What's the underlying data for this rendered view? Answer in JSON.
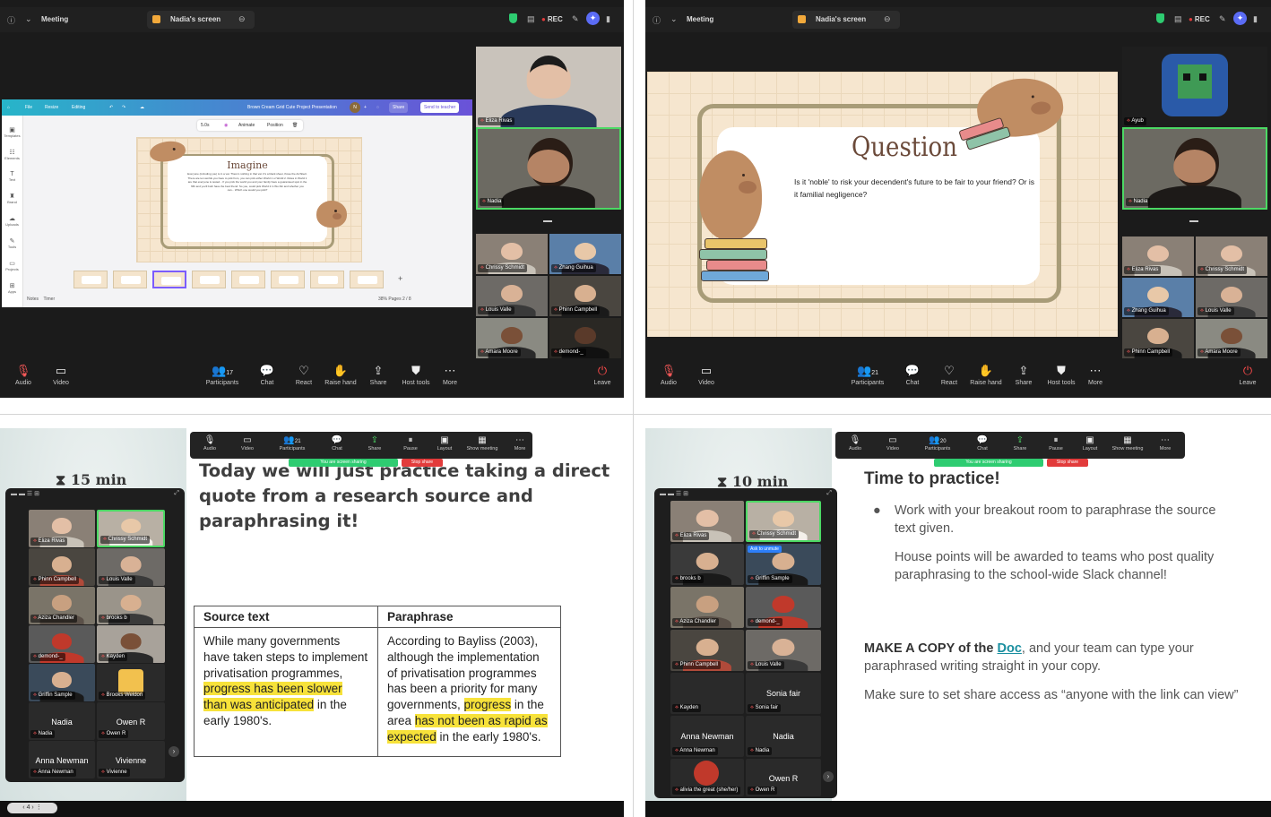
{
  "window": {
    "meeting_label": "Meeting",
    "share_tab": "Nadia's screen",
    "rec": "REC"
  },
  "toolbar": {
    "audio": "Audio",
    "video": "Video",
    "participants": "Participants",
    "chat": "Chat",
    "react": "React",
    "raise_hand": "Raise hand",
    "share": "Share",
    "host_tools": "Host tools",
    "more": "More",
    "leave": "Leave",
    "pause": "Pause",
    "layout": "Layout",
    "show_meeting": "Show meeting"
  },
  "participant_counts": {
    "p1": "17",
    "p2": "21",
    "p3": "21",
    "p4": "20"
  },
  "sharing": {
    "you_are_sharing": "You are screen sharing",
    "stop_share": "Stop share"
  },
  "p1": {
    "canva": {
      "menu": [
        "File",
        "Resize",
        "Editing"
      ],
      "doc_title": "Brown Cream Grid Cute Project Presentation",
      "share": "Share",
      "send_to_teacher": "Send to teacher",
      "tools": [
        "5.0s",
        "Animate",
        "Position"
      ],
      "sidebar": [
        "Templates",
        "Elements",
        "Text",
        "Brand",
        "Uploads",
        "Tools",
        "Projects",
        "Apps"
      ],
      "slide_title": "Imagine",
      "slide_text": "Everyone (including you) is in a vat. There's nothing in that vat. It's a black sheet, those the Architect. There are ten worlds you have to pick from, you can pick either World 1 or World 2. Rules in World 1 are that everyone is tested... If you pick the world you and your family have a guaranteed spot in the fifth and you'll both have the best friend. So you, could pick World 2 in Wo Ric and whether you can... Which one would you pick?",
      "footer_left": [
        "Notes",
        "Timer"
      ],
      "footer_right": "38%   Pages   2 / 8"
    },
    "tiles": [
      "Eliza Rivas",
      "Nadia",
      "Chrissy Schmidt",
      "Zhang Guihua",
      "Louis Valle",
      "Phinn Campbell",
      "Amara Moore",
      "demond-_"
    ]
  },
  "p2": {
    "slide": {
      "title": "Question",
      "text": "Is it 'noble' to risk your decendent's future to be fair to your friend? Or is it familial negligence?"
    },
    "tiles": [
      "Ayub",
      "Nadia",
      "Eliza Rivas",
      "Chrissy Schmidt",
      "Zhang Guihua",
      "Louis Valle",
      "Phinn Campbell",
      "Amara Moore"
    ]
  },
  "p3": {
    "timer": "15 min",
    "heading": "Today we will just practice taking a direct quote from a research source and paraphrasing it!",
    "table": {
      "headers": [
        "Source text",
        "Paraphrase"
      ],
      "source_before": "While many governments have taken steps to implement privatisation programmes, ",
      "source_hl": "progress has been slower than was anticipated",
      "source_after": " in the early 1980's.",
      "para_before": "According to Bayliss (2003), although the implementation of privatisation programmes has been a priority for many governments, ",
      "para_hl1": "progress",
      "para_mid": " in the area ",
      "para_hl2": "has not been as rapid as expected",
      "para_after": " in the early 1980's."
    },
    "gallery": [
      "Eliza Rivas",
      "Chrissy Schmidt",
      "Phinn Campbell",
      "Louis Valle",
      "Aziza Chandler",
      "brooks b",
      "demond-_",
      "Kayden",
      "Griffin Sample",
      "Brooks Weldon",
      "Nadia",
      "Owen R",
      "Anna Newman",
      "Vivienne"
    ],
    "gallery_big": [
      "Nadia",
      "Owen R",
      "Anna Newman",
      "Vivienne"
    ],
    "pager": "4"
  },
  "p4": {
    "timer": "10 min",
    "title": "Time to practice!",
    "bullet": "Work with your breakout room to paraphrase the source text given.",
    "points": "House points will be awarded to teams who post quality paraphrasing to the school-wide Slack channel!",
    "copy_bold": "MAKE A COPY of the ",
    "copy_link": "Doc",
    "copy_rest": ", and your team can type your paraphrased writing straight in your copy.",
    "share_note": "Make sure to set share access as “anyone with the link can view”",
    "ask_unmute": "Ask to unmute",
    "gallery": [
      "Eliza Rivas",
      "Chrissy Schmidt",
      "brooks b",
      "Griffin Sample",
      "Aziza Chandler",
      "demond-_",
      "Phinn Campbell",
      "Louis Valle",
      "Kayden",
      "Sonia fair",
      "Anna Newman",
      "Nadia",
      "alivia the great (she/her)",
      "Owen R"
    ],
    "gallery_big": [
      "Sonia fair",
      "Anna Newman",
      "Nadia",
      "Owen R"
    ]
  }
}
